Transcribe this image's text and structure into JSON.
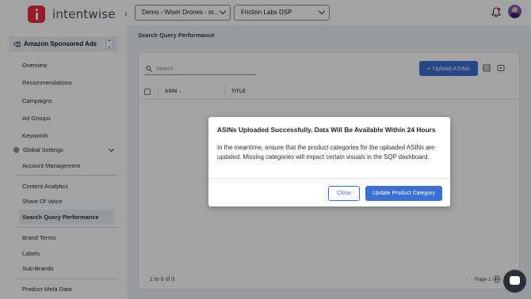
{
  "header": {
    "logo_text": "intentwise",
    "account_select": "Demo - Wiser Drones - st...",
    "profile_select": "Friction Labs DSP"
  },
  "sidebar": {
    "product": "Amazon Sponsored Ads",
    "items": [
      {
        "label": "Overview"
      },
      {
        "label": "Recommendations"
      },
      {
        "label": "Campaigns"
      },
      {
        "label": "Ad Groups"
      },
      {
        "label": "Keywords"
      }
    ],
    "global_settings": "Global Settings",
    "settings_items": [
      {
        "label": "Account Management"
      },
      {
        "label": "Content Analytics"
      },
      {
        "label": "Share Of Voice"
      },
      {
        "label": "Search Query Performance"
      },
      {
        "label": "Brand Terms"
      },
      {
        "label": "Labels"
      },
      {
        "label": "Sub-Brands"
      },
      {
        "label": "Product Meta Data"
      }
    ],
    "active_item": "Search Query Performance"
  },
  "main": {
    "page_title": "Search Query Performance",
    "search_placeholder": "Search",
    "upload_button": "Upload ASINs",
    "columns": [
      "ASIN",
      "TITLE"
    ],
    "row_count": "1 to 0 of 0",
    "pager": "Page 1 of 0"
  },
  "modal": {
    "title": "ASINs Uploaded Successfully. Data Will Be Available Within 24 Hours",
    "body": "In the meantime, ensure that the product categories for the uploaded ASINs are updated. Missing categories will impact certain visuals in the SQP dashboard.",
    "close_button": "Close",
    "update_button": "Update Product Category"
  },
  "colors": {
    "brand_red": "#e8303d",
    "accent_blue": "#3a6fd4"
  }
}
